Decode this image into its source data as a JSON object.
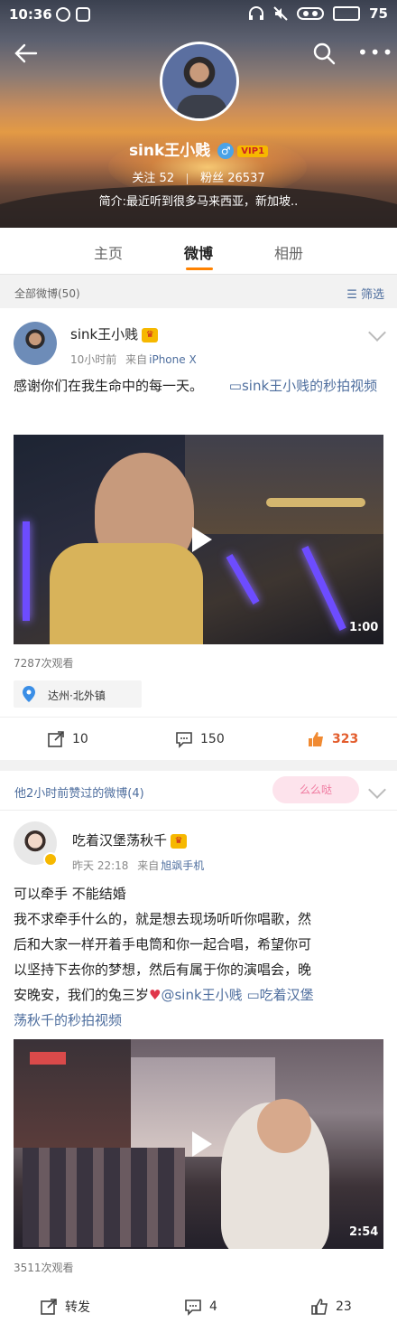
{
  "status_bar": {
    "time": "10:36",
    "battery": "75"
  },
  "profile": {
    "name": "sink王小贱",
    "vip": "VIP1",
    "following_label": "关注",
    "following": "52",
    "followers_label": "粉丝",
    "followers": "26537",
    "bio": "简介:最近听到很多马来西亚，新加坡.."
  },
  "tabs": [
    {
      "label": "主页"
    },
    {
      "label": "微博"
    },
    {
      "label": "相册"
    }
  ],
  "section": {
    "all_posts": "全部微博(50)",
    "filter": "筛选"
  },
  "post1": {
    "author": "sink王小贱",
    "time": "10小时前",
    "source_prefix": "来自",
    "source": "iPhone X",
    "text": "感谢你们在我生命中的每一天。",
    "video_link": "sink王小贱的秒拍视频",
    "duration": "1:00",
    "views": "7287次观看",
    "location": "达州·北外镇",
    "reposts": "10",
    "comments": "150",
    "likes": "323"
  },
  "liked_section": {
    "title": "他2小时前赞过的微博(4)",
    "decoration": "么么哒"
  },
  "post2": {
    "author": "吃着汉堡荡秋千",
    "time": "昨天 22:18",
    "source_prefix": "来自",
    "source": "旭飒手机",
    "line1": "可以牵手 不能结婚",
    "line2": "我不求牵手什么的，就是想去现场听听你唱歌，然",
    "line3": "后和大家一样开着手电筒和你一起合唱，希望你可",
    "line4": "以坚持下去你的梦想，然后有属于你的演唱会，晚",
    "line5_a": "安晚安，我们的兔三岁",
    "line5_mention": "@sink王小贱",
    "line5_video": "吃着汉堡",
    "line6_video": "荡秋千的秒拍视频",
    "duration": "2:54",
    "views": "3511次观看",
    "repost_label": "转发",
    "comments": "4",
    "likes": "23"
  }
}
